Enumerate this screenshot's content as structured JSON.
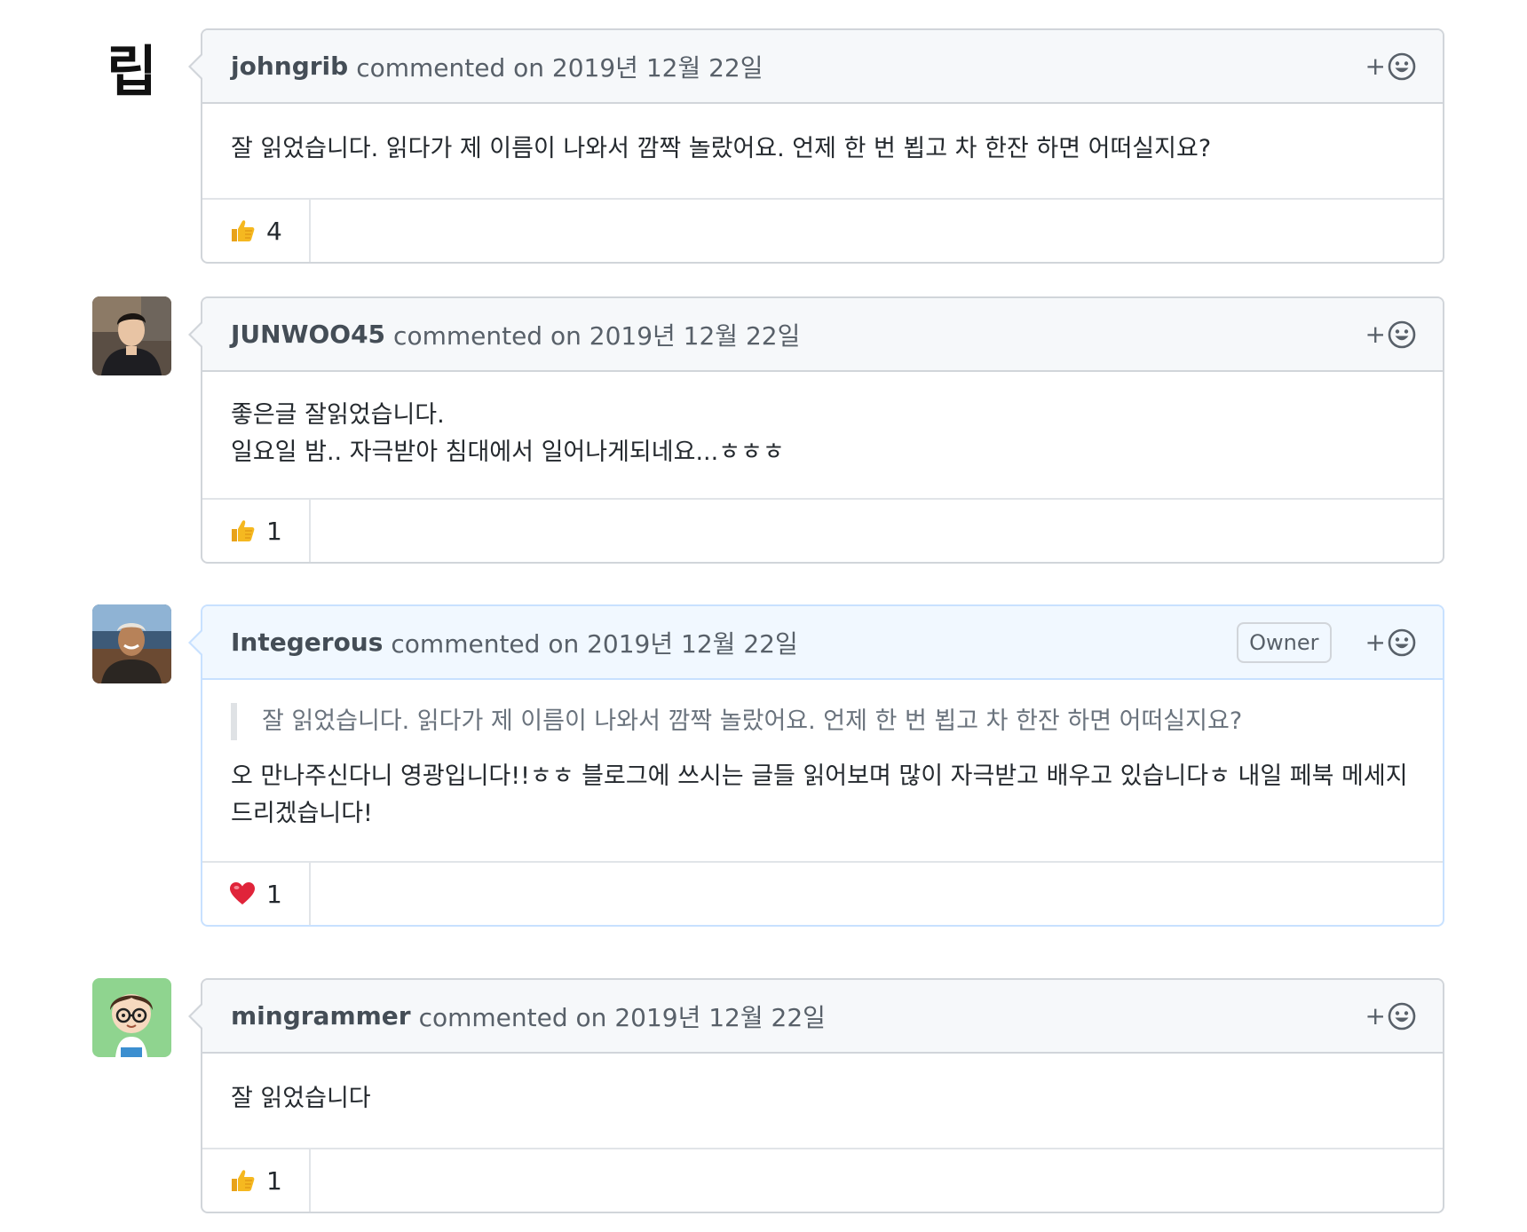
{
  "comments": [
    {
      "avatar_glyph": "립",
      "author": "johngrib",
      "timestamp": "commented on 2019년 12월 22일",
      "body_lines": [
        "잘 읽었습니다. 읽다가 제 이름이 나와서 깜짝 놀랐어요. 언제 한 번 뵙고 차 한잔 하면 어떠실지요?"
      ],
      "reaction": {
        "icon": "thumbs-up-icon",
        "count": "4"
      },
      "react_plus": "+"
    },
    {
      "author": "JUNWOO45",
      "timestamp": "commented on 2019년 12월 22일",
      "body_lines": [
        "좋은글 잘읽었습니다.",
        "일요일 밤.. 자극받아 침대에서 일어나게되네요...ㅎㅎㅎ"
      ],
      "reaction": {
        "icon": "thumbs-up-icon",
        "count": "1"
      },
      "react_plus": "+"
    },
    {
      "author": "Integerous",
      "timestamp": "commented on 2019년 12월 22일",
      "badge": "Owner",
      "quote": "잘 읽었습니다. 읽다가 제 이름이 나와서 깜짝 놀랐어요. 언제 한 번 뵙고 차 한잔 하면 어떠실지요?",
      "body_lines": [
        "오 만나주신다니 영광입니다!!ㅎㅎ 블로그에 쓰시는 글들 읽어보며 많이 자극받고 배우고 있습니다ㅎ 내일 페북 메세지 드리겠습니다!"
      ],
      "reaction": {
        "icon": "heart-icon",
        "count": "1"
      },
      "react_plus": "+"
    },
    {
      "author": "mingrammer",
      "timestamp": "commented on 2019년 12월 22일",
      "body_lines": [
        "잘 읽었습니다"
      ],
      "reaction": {
        "icon": "thumbs-up-icon",
        "count": "1"
      },
      "react_plus": "+"
    }
  ],
  "colors": {
    "border": "#d1d5da",
    "header_bg": "#f6f8fa",
    "owner_header_bg": "#f1f8ff",
    "owner_border": "#c8e1ff",
    "thumbs_up": "#f5b820",
    "heart": "#e0243a"
  }
}
